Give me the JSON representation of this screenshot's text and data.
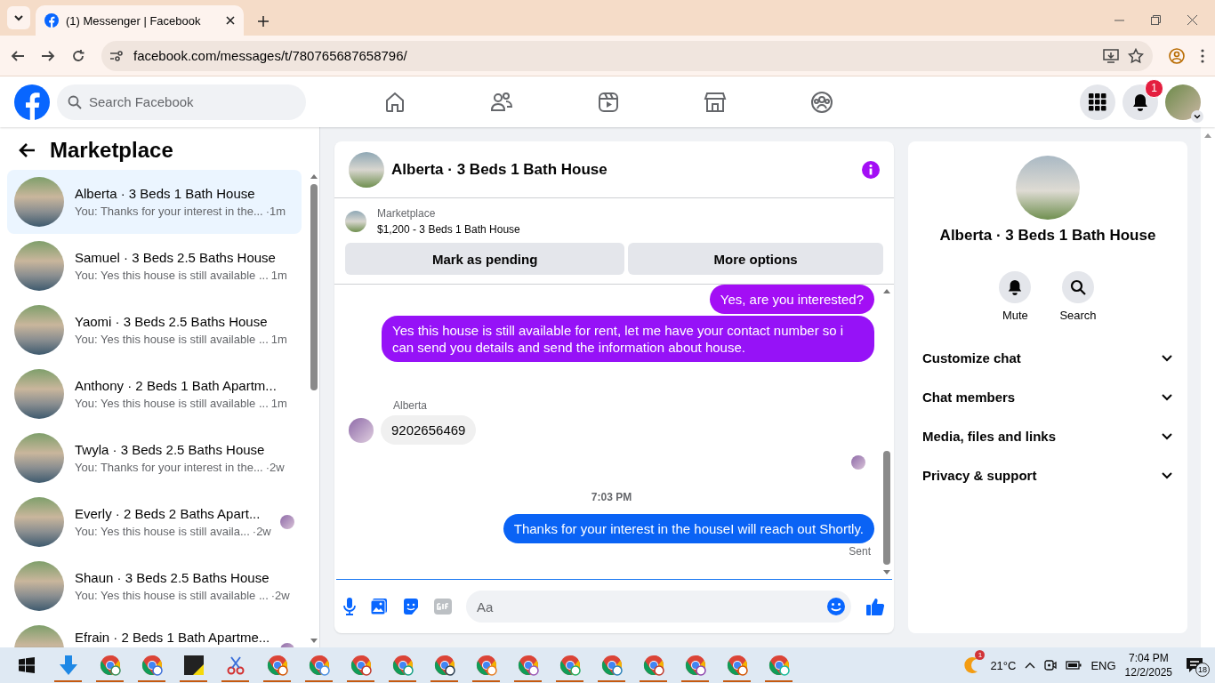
{
  "browser": {
    "tab_title": "(1) Messenger | Facebook",
    "url": "facebook.com/messages/t/780765687658796/"
  },
  "header": {
    "search_placeholder": "Search Facebook",
    "notification_badge": "1"
  },
  "sidebar": {
    "title": "Marketplace",
    "conversations": [
      {
        "title": "Alberta · 3 Beds 1 Bath House",
        "preview": "You: Thanks for your interest in the...",
        "time": "·1m",
        "selected": true,
        "seen": false
      },
      {
        "title": "Samuel · 3 Beds 2.5 Baths House",
        "preview": "You: Yes this house is still available ...",
        "time": "1m",
        "selected": false,
        "seen": false
      },
      {
        "title": "Yaomi · 3 Beds 2.5 Baths House",
        "preview": "You: Yes this house is still available ...",
        "time": "1m",
        "selected": false,
        "seen": false
      },
      {
        "title": "Anthony · 2 Beds 1 Bath Apartm...",
        "preview": "You: Yes this house is still available ...",
        "time": "1m",
        "selected": false,
        "seen": false
      },
      {
        "title": "Twyla · 3 Beds 2.5 Baths House",
        "preview": "You: Thanks for your interest in the...",
        "time": "·2w",
        "selected": false,
        "seen": false
      },
      {
        "title": "Everly · 2 Beds 2 Baths Apart...",
        "preview": "You: Yes this house is still availa...",
        "time": "·2w",
        "selected": false,
        "seen": true
      },
      {
        "title": "Shaun · 3 Beds 2.5 Baths House",
        "preview": "You: Yes this house is still available ...",
        "time": "·2w",
        "selected": false,
        "seen": false
      },
      {
        "title": "Efrain · 2 Beds 1 Bath Apartme...",
        "selected": false,
        "seen": true
      }
    ]
  },
  "chat": {
    "title": "Alberta · 3 Beds 1 Bath House",
    "listing": {
      "source": "Marketplace",
      "summary": "$1,200 - 3 Beds 1 Bath House"
    },
    "actions": [
      "Mark as pending",
      "More options"
    ],
    "messages": [
      {
        "kind": "sent",
        "text": "Yes, are you interested?",
        "color": "#a30ef5"
      },
      {
        "kind": "sent",
        "text": "Yes this house is still available for rent, let me have your contact number so i can send you details and send the information about house.",
        "color": "#9612f7"
      },
      {
        "kind": "received",
        "sender": "Alberta",
        "text": "9202656469"
      },
      {
        "kind": "seen"
      },
      {
        "kind": "time",
        "text": "7:03 PM"
      },
      {
        "kind": "sent",
        "text": "Thanks for your interest in the houseI will reach out Shortly.",
        "color": "#0a63f5"
      },
      {
        "kind": "status",
        "text": "Sent"
      }
    ],
    "composer": {
      "placeholder": "Aa"
    }
  },
  "details": {
    "title": "Alberta · 3 Beds 1 Bath House",
    "actions": [
      {
        "kind": "mute",
        "label": "Mute"
      },
      {
        "kind": "search",
        "label": "Search"
      }
    ],
    "sections": [
      {
        "label": "Customize chat",
        "expanded": false
      },
      {
        "label": "Chat members",
        "expanded": false
      },
      {
        "label": "Media, files and links",
        "expanded": false
      },
      {
        "label": "Privacy & support",
        "expanded": false
      }
    ]
  },
  "taskbar": {
    "weather_badge": "1",
    "temperature": "21°C",
    "language": "ENG",
    "time": "7:04 PM",
    "date": "12/2/2025",
    "notifications": "18"
  }
}
